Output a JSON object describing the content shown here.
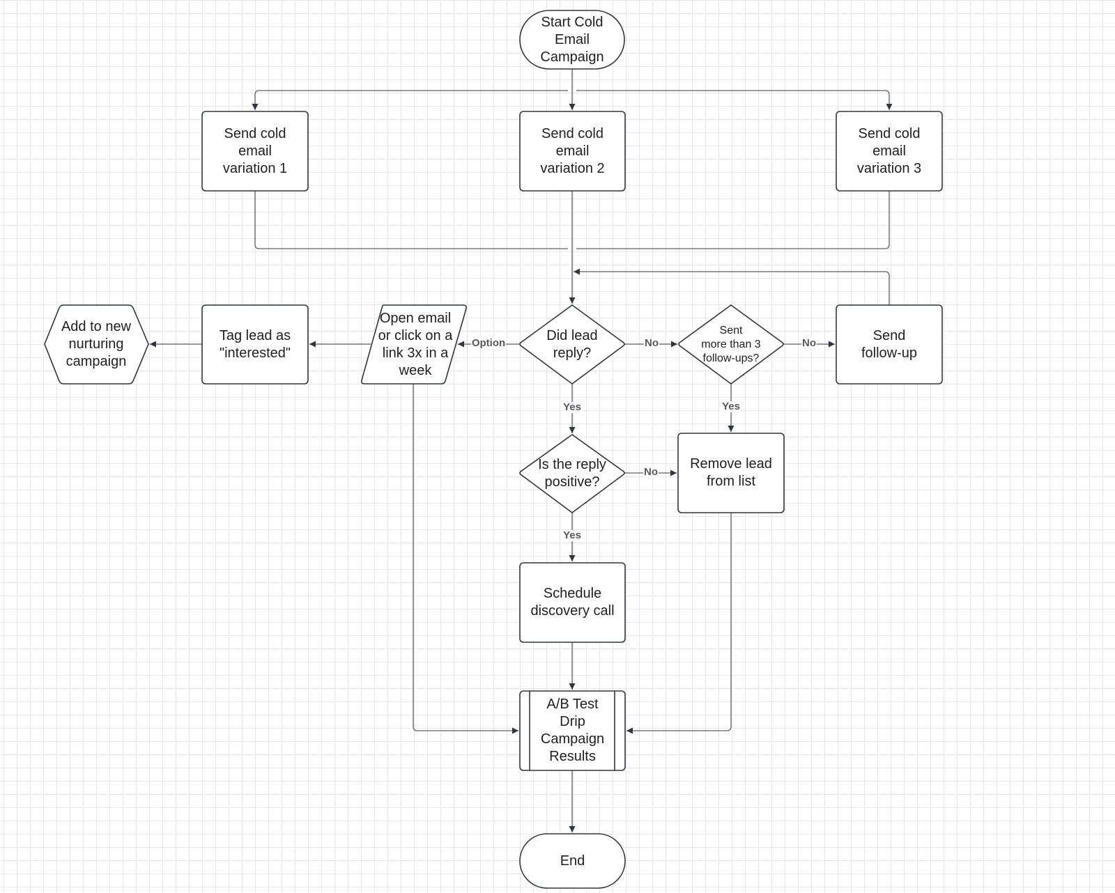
{
  "diagram": {
    "type": "flowchart",
    "colors": {
      "stroke": "#2f3640",
      "text": "#1f1f1f",
      "edge_label": "#55595f",
      "grid": "#e6e6e6",
      "fill": "#ffffff"
    },
    "nodes": {
      "start": {
        "shape": "terminator",
        "label": "Start Cold\nEmail\nCampaign"
      },
      "email1": {
        "shape": "process",
        "label": "Send cold\nemail\nvariation 1"
      },
      "email2": {
        "shape": "process",
        "label": "Send cold\nemail\nvariation 2"
      },
      "email3": {
        "shape": "process",
        "label": "Send cold\nemail\nvariation 3"
      },
      "nurture": {
        "shape": "hexagon",
        "label": "Add to new\nnurturing\ncampaign"
      },
      "tag": {
        "shape": "process",
        "label": "Tag lead as\n\"interested\""
      },
      "open": {
        "shape": "parallelogram",
        "label": "Open email\nor click on a\nlink 3x in a\nweek"
      },
      "replied": {
        "shape": "decision",
        "label": "Did lead\nreply?"
      },
      "followups": {
        "shape": "decision",
        "label": "Sent\nmore than 3\nfollow-ups?"
      },
      "sendfollow": {
        "shape": "process",
        "label": "Send\nfollow-up"
      },
      "positive": {
        "shape": "decision",
        "label": "Is the reply\npositive?"
      },
      "remove": {
        "shape": "process",
        "label": "Remove lead\nfrom list"
      },
      "schedule": {
        "shape": "process",
        "label": "Schedule\ndiscovery call"
      },
      "abtest": {
        "shape": "predefined-process",
        "label": "A/B Test\nDrip\nCampaign\nResults"
      },
      "end": {
        "shape": "terminator",
        "label": "End"
      }
    },
    "edges": [
      {
        "from": "start",
        "to": "email1",
        "label": ""
      },
      {
        "from": "start",
        "to": "email2",
        "label": ""
      },
      {
        "from": "start",
        "to": "email3",
        "label": ""
      },
      {
        "from": "email1",
        "to": "replied",
        "label": ""
      },
      {
        "from": "email2",
        "to": "replied",
        "label": ""
      },
      {
        "from": "email3",
        "to": "replied",
        "label": ""
      },
      {
        "from": "replied",
        "to": "open",
        "label": "Option"
      },
      {
        "from": "replied",
        "to": "followups",
        "label": "No"
      },
      {
        "from": "replied",
        "to": "positive",
        "label": "Yes"
      },
      {
        "from": "followups",
        "to": "sendfollow",
        "label": "No"
      },
      {
        "from": "followups",
        "to": "remove",
        "label": "Yes"
      },
      {
        "from": "sendfollow",
        "to": "replied",
        "label": ""
      },
      {
        "from": "open",
        "to": "tag",
        "label": ""
      },
      {
        "from": "tag",
        "to": "nurture",
        "label": ""
      },
      {
        "from": "open",
        "to": "abtest",
        "label": ""
      },
      {
        "from": "positive",
        "to": "remove",
        "label": "No"
      },
      {
        "from": "positive",
        "to": "schedule",
        "label": "Yes"
      },
      {
        "from": "schedule",
        "to": "abtest",
        "label": ""
      },
      {
        "from": "remove",
        "to": "abtest",
        "label": ""
      },
      {
        "from": "abtest",
        "to": "end",
        "label": ""
      }
    ]
  }
}
